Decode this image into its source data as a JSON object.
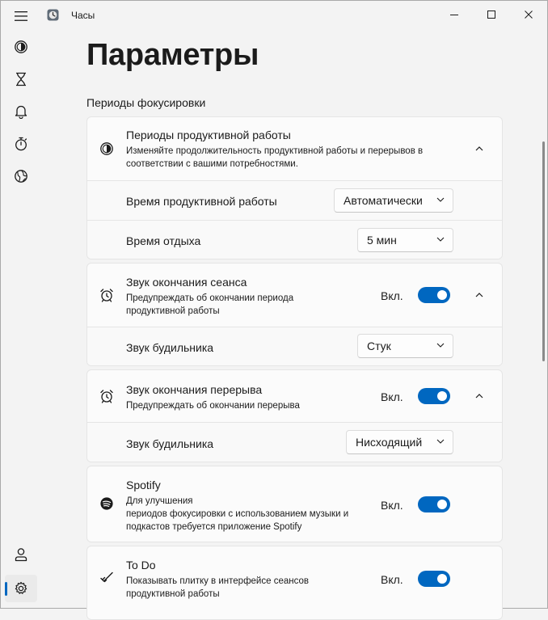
{
  "window": {
    "title": "Часы"
  },
  "sidebar": {
    "items": [
      {
        "name": "focus-sessions",
        "icon": "focus-icon"
      },
      {
        "name": "timer",
        "icon": "hourglass-icon"
      },
      {
        "name": "alarm",
        "icon": "bell-icon"
      },
      {
        "name": "stopwatch",
        "icon": "stopwatch-icon"
      },
      {
        "name": "world-clock",
        "icon": "globe-icon"
      }
    ],
    "account_icon": "person-icon",
    "settings_icon": "gear-icon"
  },
  "page": {
    "title": "Параметры",
    "section": "Периоды фокусировки"
  },
  "cards": {
    "productive": {
      "title": "Периоды продуктивной работы",
      "description_line1": "Изменяйте продолжительность продуктивной работы и перерывов в",
      "description_line2": "соответствии с вашими потребностями.",
      "work_time_label": "Время продуктивной работы",
      "work_time_value": "Автоматически",
      "rest_time_label": "Время отдыха",
      "rest_time_value": "5 мин"
    },
    "session_end": {
      "title": "Звук окончания сеанса",
      "description_line1": "Предупреждать об окончании периода",
      "description_line2": "продуктивной работы",
      "toggle_label": "Вкл.",
      "toggle_on": true,
      "alarm_label": "Звук будильника",
      "alarm_value": "Стук"
    },
    "break_end": {
      "title": "Звук окончания перерыва",
      "description_line1": "Предупреждать об окончании перерыва",
      "toggle_label": "Вкл.",
      "toggle_on": true,
      "alarm_label": "Звук будильника",
      "alarm_value": "Нисходящий"
    },
    "spotify": {
      "title": "Spotify",
      "description_line1": "Для улучшения",
      "description_line2": "периодов фокусировки с использованием музыки и",
      "description_line3": "подкастов требуется приложение Spotify",
      "toggle_label": "Вкл.",
      "toggle_on": true
    },
    "todo": {
      "title": "To Do",
      "description_line1": "Показывать плитку в интерфейсе сеансов",
      "description_line2": "продуктивной работы",
      "toggle_label": "Вкл.",
      "toggle_on": true
    }
  },
  "colors": {
    "accent": "#0067c0",
    "background": "#f3f3f3",
    "card": "#fbfbfb"
  }
}
